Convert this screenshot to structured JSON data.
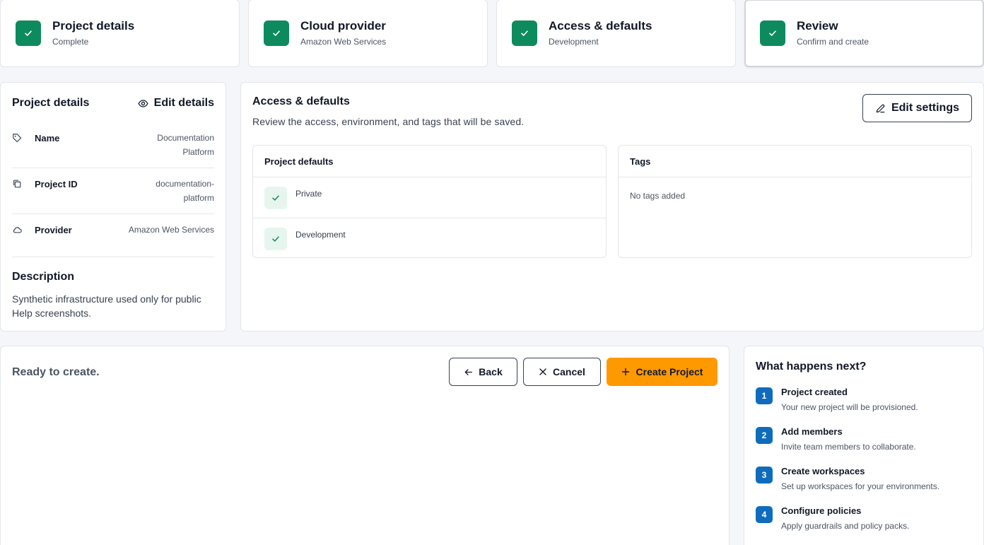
{
  "steps": [
    {
      "title": "Project details",
      "subtitle": "Complete"
    },
    {
      "title": "Cloud provider",
      "subtitle": "Amazon Web Services"
    },
    {
      "title": "Access & defaults",
      "subtitle": "Development"
    },
    {
      "title": "Review",
      "subtitle": "Confirm and create"
    }
  ],
  "project_details": {
    "title": "Project details",
    "edit_label": "Edit details",
    "rows": [
      {
        "label": "Name",
        "value": "Documentation Platform",
        "icon": "tag-icon"
      },
      {
        "label": "Project ID",
        "value": "documentation-platform",
        "icon": "copy-icon"
      },
      {
        "label": "Provider",
        "value": "Amazon Web Services",
        "icon": "cloud-icon"
      }
    ],
    "description_title": "Description",
    "description": "Synthetic infrastructure used only for public Help screenshots."
  },
  "access_defaults": {
    "title": "Access & defaults",
    "subtitle": "Review the access, environment, and tags that will be saved.",
    "edit_label": "Edit settings",
    "defaults_title": "Project defaults",
    "defaults": [
      "Private",
      "Development"
    ],
    "tags_title": "Tags",
    "tags_empty": "No tags added"
  },
  "actions": {
    "ready_text": "Ready to create.",
    "back_label": "Back",
    "cancel_label": "Cancel",
    "create_label": "Create Project"
  },
  "next_steps": {
    "title": "What happens next?",
    "items": [
      {
        "num": "1",
        "name": "Project created",
        "desc": "Your new project will be provisioned."
      },
      {
        "num": "2",
        "name": "Add members",
        "desc": "Invite team members to collaborate."
      },
      {
        "num": "3",
        "name": "Create workspaces",
        "desc": "Set up workspaces for your environments."
      },
      {
        "num": "4",
        "name": "Configure policies",
        "desc": "Apply guardrails and policy packs."
      }
    ]
  },
  "colors": {
    "success": "#0e8a5f",
    "success_soft": "#e6f6ef",
    "primary_action": "#ff9900",
    "number_badge": "#0f6cbd"
  }
}
